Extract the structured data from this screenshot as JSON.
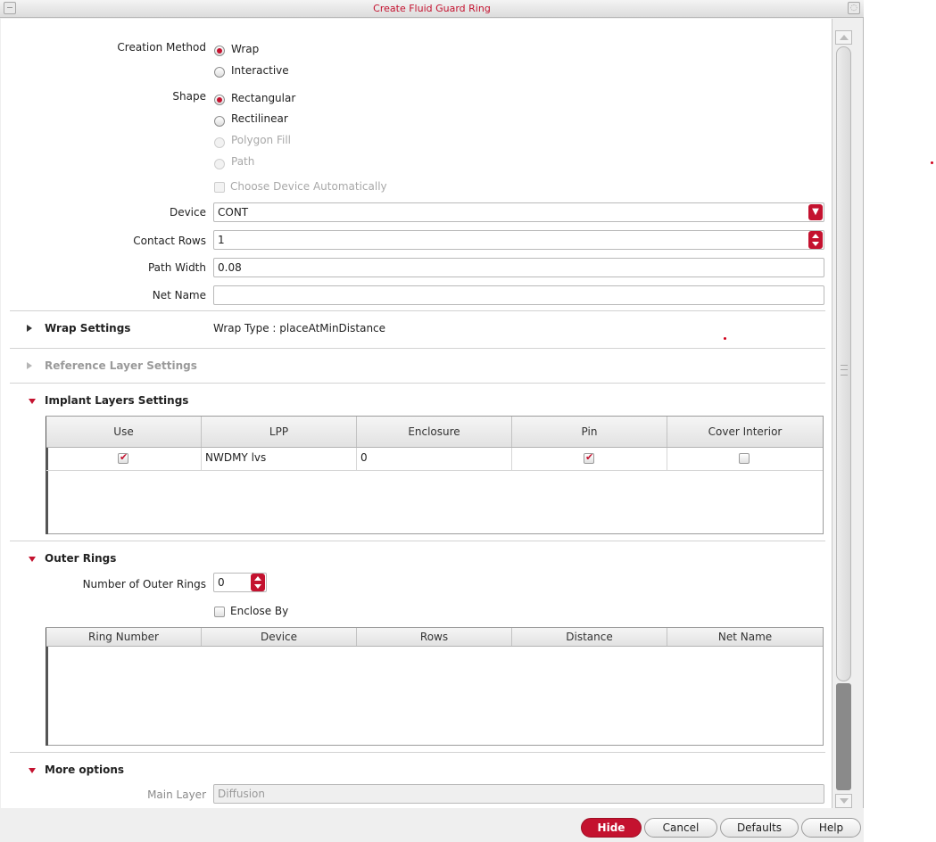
{
  "window": {
    "title": "Create Fluid Guard Ring"
  },
  "form": {
    "creation_method": {
      "label": "Creation Method",
      "options": [
        "Wrap",
        "Interactive"
      ],
      "selected": "Wrap"
    },
    "shape": {
      "label": "Shape",
      "options": [
        "Rectangular",
        "Rectilinear",
        "Polygon Fill",
        "Path"
      ],
      "selected": "Rectangular"
    },
    "choose_device": {
      "label": "Choose Device Automatically",
      "checked": false
    },
    "device": {
      "label": "Device",
      "value": "CONT"
    },
    "contact_rows": {
      "label": "Contact Rows",
      "value": "1"
    },
    "path_width": {
      "label": "Path Width",
      "value": "0.08"
    },
    "net_name": {
      "label": "Net Name",
      "value": ""
    }
  },
  "wrap_settings": {
    "label": "Wrap Settings",
    "summary": "Wrap Type : placeAtMinDistance"
  },
  "reference_layer": {
    "label": "Reference Layer Settings"
  },
  "implant": {
    "label": "Implant Layers Settings",
    "columns": [
      "Use",
      "LPP",
      "Enclosure",
      "Pin",
      "Cover Interior"
    ],
    "rows": [
      {
        "use": true,
        "lpp": "NWDMY lvs",
        "enclosure": "0",
        "pin": true,
        "cover_interior": false
      }
    ]
  },
  "outer_rings": {
    "label": "Outer Rings",
    "count_label": "Number of Outer Rings",
    "count_value": "0",
    "enclose_by": "Enclose By",
    "columns": [
      "Ring Number",
      "Device",
      "Rows",
      "Distance",
      "Net Name"
    ]
  },
  "more_options": {
    "label": "More options",
    "main_layer_label": "Main Layer",
    "main_layer_value": "Diffusion"
  },
  "buttons": {
    "hide": "Hide",
    "cancel": "Cancel",
    "defaults": "Defaults",
    "help": "Help"
  },
  "colors": {
    "accent": "#c4122f"
  }
}
